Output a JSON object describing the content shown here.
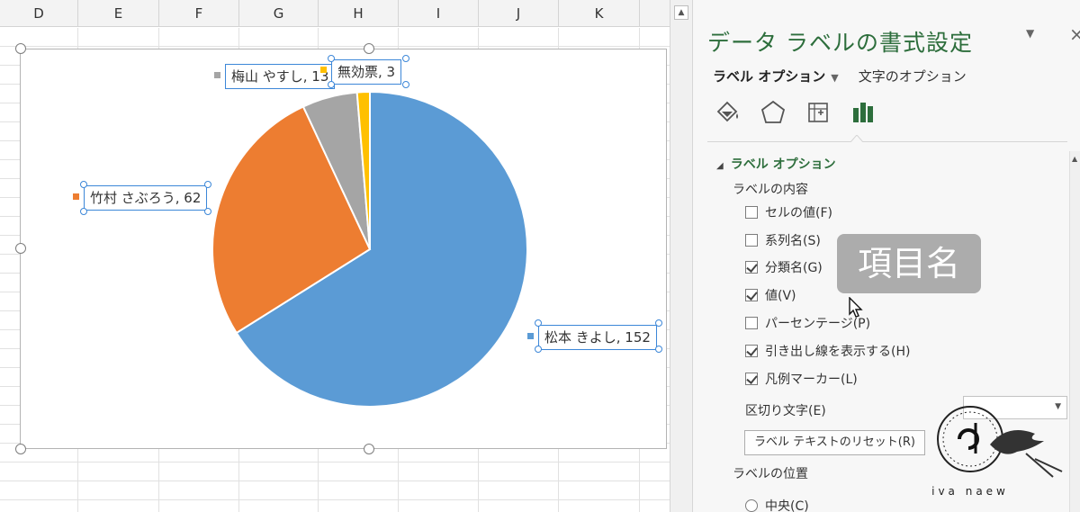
{
  "sheet": {
    "columns": [
      "D",
      "E",
      "F",
      "G",
      "H",
      "I",
      "J",
      "K"
    ]
  },
  "chart_data": {
    "type": "pie",
    "categories": [
      "松本 きよし",
      "竹村 さぶろう",
      "梅山 やすし",
      "無効票"
    ],
    "values": [
      152,
      62,
      13,
      3
    ],
    "colors": [
      "#5b9bd5",
      "#ed7d31",
      "#a5a5a5",
      "#ffc000"
    ],
    "data_labels": [
      "松本 きよし, 152",
      "竹村 さぶろう, 62",
      "梅山 やすし, 13",
      "無効票, 3"
    ]
  },
  "pane": {
    "title": "データ ラベルの書式設定",
    "tab_label_options": "ラベル オプション",
    "tab_text_options": "文字のオプション",
    "icons": [
      "fill-bucket-icon",
      "pentagon-icon",
      "size-properties-icon",
      "bar-chart-icon"
    ],
    "section_title": "ラベル オプション",
    "label_contents_heading": "ラベルの内容",
    "options": [
      {
        "label": "セルの値(F)",
        "checked": false
      },
      {
        "label": "系列名(S)",
        "checked": false
      },
      {
        "label": "分類名(G)",
        "checked": true
      },
      {
        "label": "値(V)",
        "checked": true
      },
      {
        "label": "パーセンテージ(P)",
        "checked": false
      },
      {
        "label": "引き出し線を表示する(H)",
        "checked": true
      },
      {
        "label": "凡例マーカー(L)",
        "checked": true
      }
    ],
    "separator_label": "区切り文字(E)",
    "separator_value": "",
    "reset_button": "ラベル テキストのリセット(R)",
    "position_heading": "ラベルの位置",
    "position_center": "中央(C)"
  },
  "tooltip": {
    "text": "項目名"
  },
  "watermark": {
    "text": "iva naew"
  }
}
